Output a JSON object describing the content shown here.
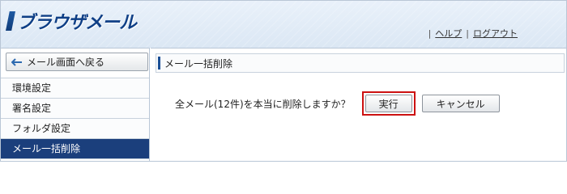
{
  "app": {
    "logo_text": "ブラウザメール"
  },
  "header": {
    "links": [
      {
        "label": "ヘルプ"
      },
      {
        "label": "ログアウト"
      }
    ]
  },
  "sidebar": {
    "back_button": "メール画面へ戻る",
    "items": [
      {
        "label": "環境設定"
      },
      {
        "label": "署名設定"
      },
      {
        "label": "フォルダ設定"
      },
      {
        "label": "メール一括削除"
      }
    ]
  },
  "main": {
    "title": "メール一括削除",
    "confirm_text": "全メール(12件)を本当に削除しますか？",
    "execute_label": "実行",
    "cancel_label": "キャンセル"
  },
  "colors": {
    "nav_active": "#1b3f7c",
    "highlight_border": "#cc1111"
  }
}
